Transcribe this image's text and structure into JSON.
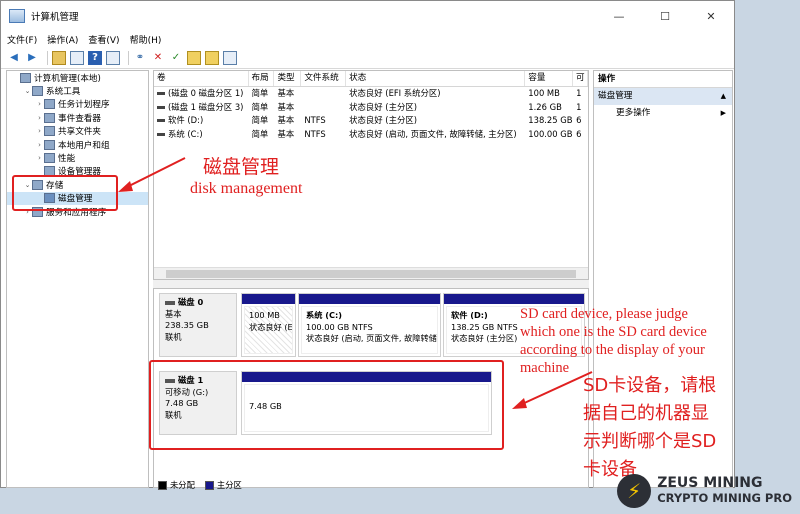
{
  "window": {
    "title": "计算机管理",
    "controls": {
      "minimize": "—",
      "maximize": "☐",
      "close": "✕"
    }
  },
  "menu": [
    "文件(F)",
    "操作(A)",
    "查看(V)",
    "帮助(H)"
  ],
  "tree": [
    {
      "label": "计算机管理(本地)",
      "level": 0,
      "expander": "",
      "icon": "computer-icon"
    },
    {
      "label": "系统工具",
      "level": 1,
      "expander": "⌄",
      "icon": "tools-icon"
    },
    {
      "label": "任务计划程序",
      "level": 2,
      "expander": "›",
      "icon": "clock-icon"
    },
    {
      "label": "事件查看器",
      "level": 2,
      "expander": "›",
      "icon": "event-viewer-icon"
    },
    {
      "label": "共享文件夹",
      "level": 2,
      "expander": "›",
      "icon": "shared-folder-icon"
    },
    {
      "label": "本地用户和组",
      "level": 2,
      "expander": "›",
      "icon": "users-icon"
    },
    {
      "label": "性能",
      "level": 2,
      "expander": "›",
      "icon": "performance-icon"
    },
    {
      "label": "设备管理器",
      "level": 2,
      "expander": "",
      "icon": "device-manager-icon"
    },
    {
      "label": "存储",
      "level": 1,
      "expander": "⌄",
      "icon": "storage-icon"
    },
    {
      "label": "磁盘管理",
      "level": 2,
      "expander": "",
      "icon": "disk-management-icon",
      "selected": true
    },
    {
      "label": "服务和应用程序",
      "level": 1,
      "expander": "›",
      "icon": "services-icon"
    }
  ],
  "volume_table": {
    "headers": [
      "卷",
      "布局",
      "类型",
      "文件系统",
      "状态",
      "容量",
      "可"
    ],
    "rows": [
      [
        "(磁盘 0 磁盘分区 1)",
        "简单",
        "基本",
        "",
        "状态良好 (EFI 系统分区)",
        "100 MB",
        "1"
      ],
      [
        "(磁盘 1 磁盘分区 3)",
        "简单",
        "基本",
        "",
        "状态良好 (主分区)",
        "1.26 GB",
        "1"
      ],
      [
        "软件 (D:)",
        "简单",
        "基本",
        "NTFS",
        "状态良好 (主分区)",
        "138.25 GB",
        "6"
      ],
      [
        "系统 (C:)",
        "简单",
        "基本",
        "NTFS",
        "状态良好 (启动, 页面文件, 故障转储, 主分区)",
        "100.00 GB",
        "6"
      ]
    ]
  },
  "disks": [
    {
      "name": "磁盘 0",
      "lines": [
        "基本",
        "238.35 GB",
        "联机"
      ],
      "partitions": [
        {
          "name": "",
          "lines": [
            "100 MB",
            "状态良好 (E"
          ],
          "hatched": true
        },
        {
          "name": "系统 (C:)",
          "lines": [
            "100.00 GB NTFS",
            "状态良好 (启动, 页面文件, 故障转储"
          ],
          "hatched": false
        },
        {
          "name": "软件 (D:)",
          "lines": [
            "138.25 GB NTFS",
            "状态良好 (主分区)"
          ],
          "hatched": false
        }
      ]
    },
    {
      "name": "磁盘 1",
      "lines": [
        "可移动 (G:)",
        "7.48 GB",
        "联机"
      ],
      "partitions": [
        {
          "name": "",
          "lines": [
            "7.48 GB"
          ],
          "hatched": false
        }
      ]
    }
  ],
  "legend": [
    {
      "label": "未分配",
      "color": "#000000"
    },
    {
      "label": "主分区",
      "color": "#18188c"
    }
  ],
  "actions": {
    "header": "操作",
    "section": "磁盘管理",
    "item": "更多操作"
  },
  "annotations": {
    "disk_mgmt_cn": "磁盘管理",
    "disk_mgmt_en": "disk management",
    "sd_en": [
      "SD card device, please judge",
      "which one is the SD card device",
      "according to the display of your",
      "machine"
    ],
    "sd_cn": [
      "SD卡设备，请根",
      "据自己的机器显",
      "示判断哪个是SD",
      "卡设备"
    ]
  },
  "brand": {
    "line1": "ZEUS MINING",
    "line2": "CRYPTO MINING PRO"
  },
  "colors": {
    "annotation": "#e02020",
    "primary_partition": "#18188c",
    "selected": "#cce4f7"
  }
}
